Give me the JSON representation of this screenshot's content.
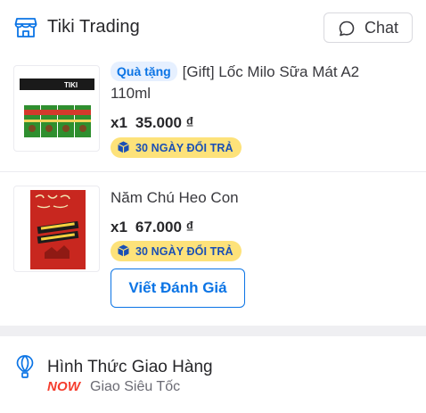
{
  "shop": {
    "name": "Tiki Trading",
    "chat_label": "Chat"
  },
  "products": [
    {
      "gift_badge": "Quà tặng",
      "title": "[Gift] Lốc Milo Sữa Mát A2 110ml",
      "quantity": "x1",
      "price": "35.000 ₫",
      "return_badge": "30 NGÀY ĐỔI TRẢ",
      "thumbnail_brand": "TIKI"
    },
    {
      "title": "Năm Chú Heo Con",
      "quantity": "x1",
      "price": "67.000 ₫",
      "return_badge": "30 NGÀY ĐỔI TRẢ",
      "review_label": "Viết Đánh Giá"
    }
  ],
  "shipping": {
    "title": "Hình Thức Giao Hàng",
    "now_label": "NOW",
    "method": "Giao Siêu Tốc"
  },
  "colors": {
    "accent": "#0b74e5",
    "return_badge_bg": "#fde27a",
    "now_red": "#f53d2d",
    "book_cover": "#c8271f"
  }
}
